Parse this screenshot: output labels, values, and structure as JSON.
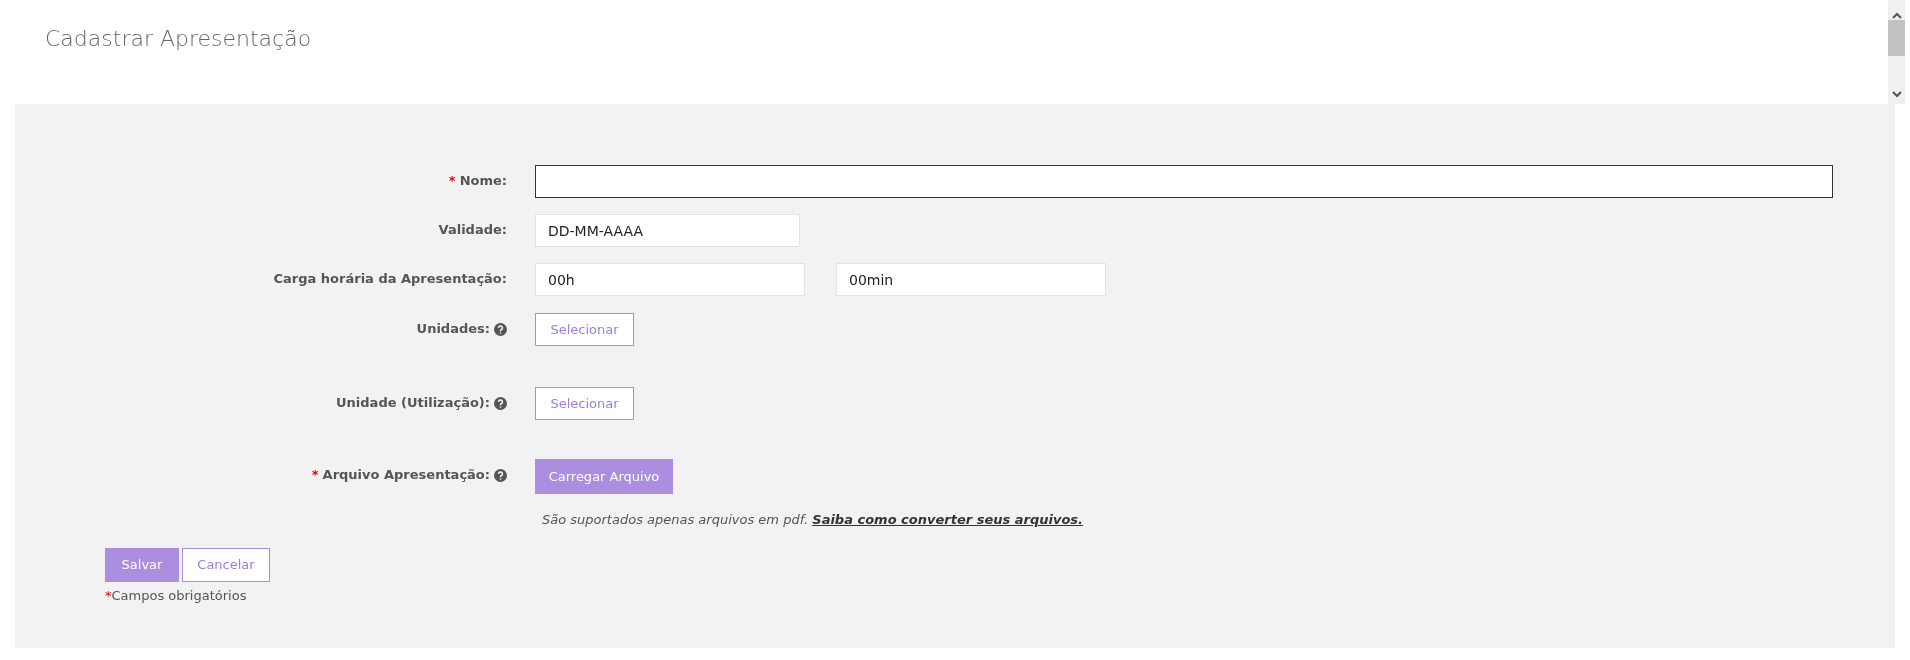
{
  "page_title": "Cadastrar Apresentação",
  "fields": [
    {
      "kind": "text",
      "label": "Nome:",
      "required": true,
      "help": false,
      "focused": true
    },
    {
      "kind": "date",
      "label": "Validade:",
      "required": false,
      "help": false,
      "value": "DD-MM-AAAA"
    },
    {
      "kind": "duration",
      "label": "Carga horária da Apresentação:",
      "required": false,
      "help": false,
      "hours": "00h",
      "minutes": "00min"
    },
    {
      "kind": "select",
      "label": "Unidades:",
      "required": false,
      "help": true,
      "button": "Selecionar"
    },
    {
      "kind": "select",
      "label": "Unidade (Utilização):",
      "required": false,
      "help": true,
      "button": "Selecionar"
    },
    {
      "kind": "upload",
      "label": "Arquivo Apresentação:",
      "required": true,
      "help": true,
      "button": "Carregar Arquivo",
      "note": "São suportados apenas arquivos em pdf.",
      "link": "Saiba como converter seus arquivos."
    }
  ],
  "required_mark": "*",
  "actions": {
    "save": "Salvar",
    "cancel": "Cancelar"
  },
  "required_note": "Campos obrigatórios"
}
